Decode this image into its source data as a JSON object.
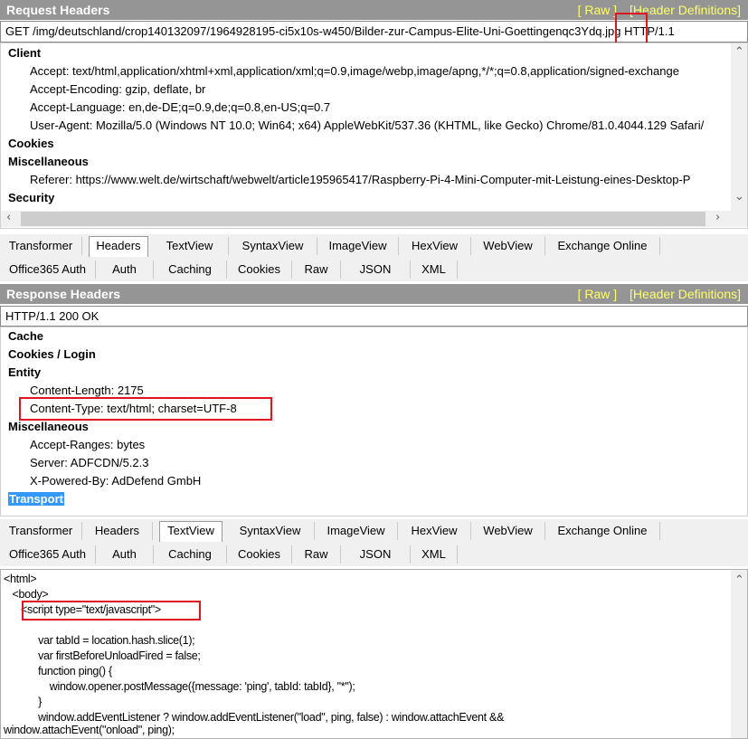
{
  "request": {
    "title": "Request Headers",
    "raw_link": "[ Raw ]",
    "defs_link": "[Header Definitions]",
    "request_line": "GET /img/deutschland/crop140132097/1964928195-ci5x10s-w450/Bilder-zur-Campus-Elite-Uni-Goettingenqc3Ydq.jpg HTTP/1.1",
    "sections": {
      "client": "Client",
      "cookies": "Cookies",
      "misc": "Miscellaneous",
      "security": "Security"
    },
    "client_items": [
      "Accept: text/html,application/xhtml+xml,application/xml;q=0.9,image/webp,image/apng,*/*;q=0.8,application/signed-exchange",
      "Accept-Encoding: gzip, deflate, br",
      "Accept-Language: en,de-DE;q=0.9,de;q=0.8,en-US;q=0.7",
      "User-Agent: Mozilla/5.0 (Windows NT 10.0; Win64; x64) AppleWebKit/537.36 (KHTML, like Gecko) Chrome/81.0.4044.129 Safari/"
    ],
    "misc_items": [
      "Referer: https://www.welt.de/wirtschaft/webwelt/article195965417/Raspberry-Pi-4-Mini-Computer-mit-Leistung-eines-Desktop-P"
    ]
  },
  "tabs_top": {
    "row1": [
      "Transformer",
      "Headers",
      "TextView",
      "SyntaxView",
      "ImageView",
      "HexView",
      "WebView",
      "Exchange Online"
    ],
    "row2": [
      "Office365 Auth",
      "Auth",
      "Caching",
      "Cookies",
      "Raw",
      "JSON",
      "XML"
    ]
  },
  "response": {
    "title": "Response Headers",
    "raw_link": "[ Raw ]",
    "defs_link": "[Header Definitions]",
    "status_line": "HTTP/1.1 200 OK",
    "sections": {
      "cache": "Cache",
      "cookies_login": "Cookies / Login",
      "entity": "Entity",
      "misc": "Miscellaneous",
      "transport": "Transport"
    },
    "entity_items": [
      "Content-Length: 2175",
      "Content-Type: text/html; charset=UTF-8"
    ],
    "misc_items": [
      "Accept-Ranges: bytes",
      "Server: ADFCDN/5.2.3",
      "X-Powered-By: AdDefend GmbH"
    ]
  },
  "tabs_bottom": {
    "row1": [
      "Transformer",
      "Headers",
      "TextView",
      "SyntaxView",
      "ImageView",
      "HexView",
      "WebView",
      "Exchange Online"
    ],
    "row2": [
      "Office365 Auth",
      "Auth",
      "Caching",
      "Cookies",
      "Raw",
      "JSON",
      "XML"
    ]
  },
  "textview": {
    "lines": [
      "<html>",
      "   <body>",
      "      <script type=\"text/javascript\">",
      "",
      "            var tabId = location.hash.slice(1);",
      "            var firstBeforeUnloadFired = false;",
      "            function ping() {",
      "                window.opener.postMessage({message: 'ping', tabId: tabId}, \"*\");",
      "            }",
      "            window.addEventListener ? window.addEventListener(\"load\", ping, false) : window.attachEvent &&",
      "window.attachEvent(\"onload\", ping);"
    ]
  },
  "colors": {
    "header_bg": "#959595",
    "link_yellow": "#ffff66",
    "highlight_red": "#e0141e",
    "selection_blue": "#3399ff"
  }
}
